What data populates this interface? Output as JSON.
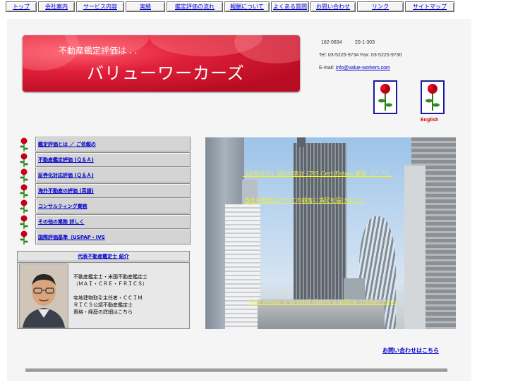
{
  "nav": [
    {
      "label": "トップ"
    },
    {
      "label": "会社案内"
    },
    {
      "label": "サービス内容"
    },
    {
      "label": "実績"
    },
    {
      "label": "鑑定評価の流れ"
    },
    {
      "label": "報酬について"
    },
    {
      "label": "よくある質問"
    },
    {
      "label": "お問い合わせ"
    },
    {
      "label": "リンク"
    },
    {
      "label": "サイトマップ"
    }
  ],
  "banner": {
    "subtitle": "不動産鑑定評価は . .",
    "title": "バリューワーカーズ"
  },
  "contact": {
    "postal": "162-0834",
    "address": "20-1-303",
    "tel_fax": "Tel: 03-5225-9734 Fax: 03-5225-9730",
    "email_label": "E-mail:",
    "email": "info@value-workers.com"
  },
  "english_label": "English",
  "menu": [
    {
      "label": "鑑定評価とは ／ ご依頼の"
    },
    {
      "label": "不動産鑑定評価 (Ｑ＆Ａ)"
    },
    {
      "label": "証券化対応評価 (Ｑ＆Ａ)"
    },
    {
      "label": "海外不動産の評価 (英語)"
    },
    {
      "label": "コンサルティング業務"
    },
    {
      "label": "その他の業務 詳しく"
    },
    {
      "label": "国際評価基準（USPAP・IVS"
    }
  ],
  "profile": {
    "heading": "代表不動産鑑定士 紹介",
    "lines": [
      "不動産鑑定士・米国不動産鑑定士",
      "（ＭＡＩ・ＣＲＥ・ＦＲＩＣＳ）",
      "",
      "宅地建物取引主任者・ＣＣＩＭ",
      "ＲＩＣＳ公認不動産鑑定士",
      "資格・経歴の詳細はこちら"
    ]
  },
  "city_photo": {
    "line1": "【お知らせ】当社代表が CRS CertiEstate 取得 （^_^）",
    "line2": "当社の理念は すべての顧客に満足を届けること",
    "line3": "Our dream is to send clients a million custom steps"
  },
  "footer_link": "お問い合わせはこちら"
}
